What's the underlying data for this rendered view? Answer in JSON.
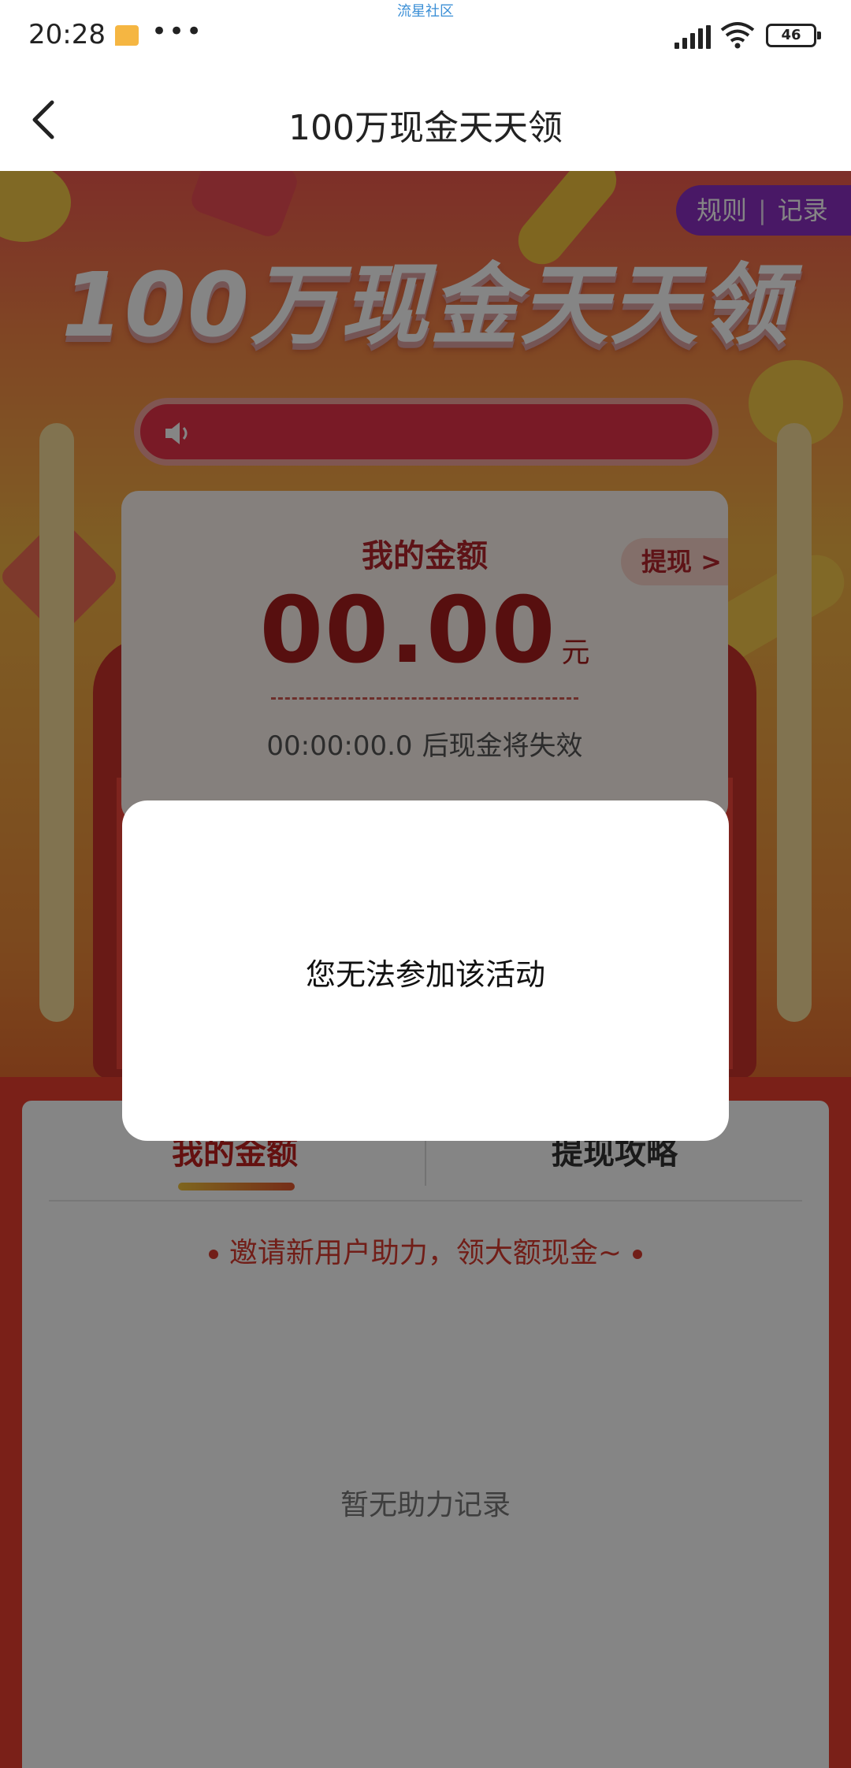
{
  "status_bar": {
    "watermark": "流星社区",
    "time": "20:28",
    "battery": "46",
    "icons": [
      "notification-icon",
      "more-dots-icon",
      "signal-icon",
      "wifi-icon",
      "battery-icon"
    ]
  },
  "nav": {
    "title": "100万现金天天领",
    "back_icon": "chevron-left-icon"
  },
  "banner": {
    "rules_label": "规则",
    "records_label": "记录",
    "separator": "|",
    "title": "100万现金天天领",
    "speaker_icon": "speaker-icon"
  },
  "amount_card": {
    "label": "我的金额",
    "withdraw_label": "提现 >",
    "amount": "00.00",
    "unit": "元",
    "countdown": "00:00:00.0",
    "countdown_suffix": "后现金将失效"
  },
  "tabs": {
    "mine": "我的金额",
    "guide": "提现攻略",
    "invite_text": "邀请新用户助力，领大额现金~",
    "empty_text": "暂无助力记录"
  },
  "dialog": {
    "message": "您无法参加该活动"
  },
  "colors": {
    "accent_red": "#c0221f",
    "rules_purple": "#8c2fc4",
    "overlay": "rgba(0,0,0,0.48)"
  }
}
